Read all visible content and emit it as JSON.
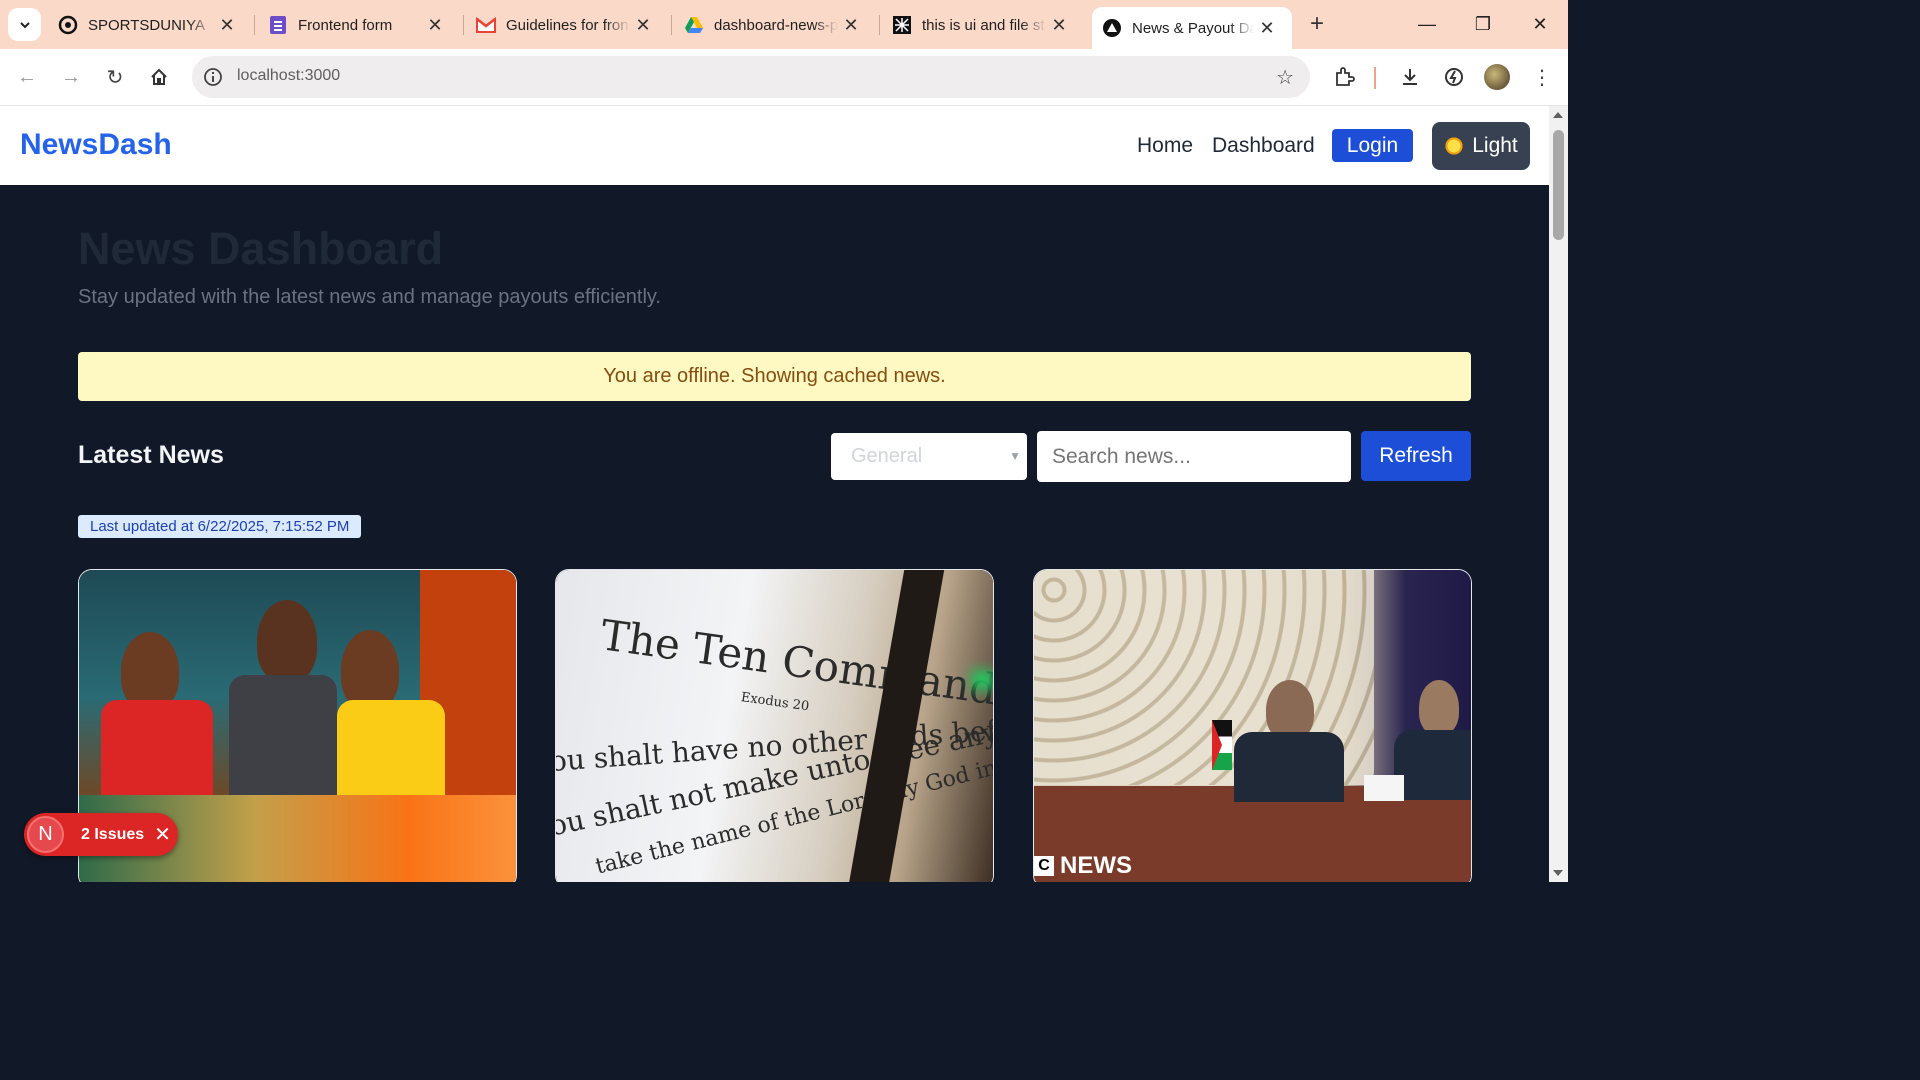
{
  "browser": {
    "tabs": [
      {
        "title": "SPORTSDUNIYA",
        "icon": "sportsduniya-icon"
      },
      {
        "title": "Frontend form",
        "icon": "forms-icon"
      },
      {
        "title": "Guidelines for fron",
        "icon": "gmail-icon"
      },
      {
        "title": "dashboard-news-p",
        "icon": "drive-icon"
      },
      {
        "title": "this is ui and file st",
        "icon": "grid-app-icon"
      },
      {
        "title": "News & Payout Da",
        "icon": "vercel-icon",
        "active": true
      }
    ],
    "url": "localhost:3000"
  },
  "navbar": {
    "brand": "NewsDash",
    "links": [
      "Home",
      "Dashboard"
    ],
    "login_label": "Login",
    "theme_label": "Light"
  },
  "hero": {
    "title": "News Dashboard",
    "subtitle": "Stay updated with the latest news and manage payouts efficiently."
  },
  "offline_banner": "You are offline. Showing cached news.",
  "news": {
    "heading": "Latest News",
    "category_selected": "General",
    "search_placeholder": "Search news...",
    "refresh_label": "Refresh",
    "last_updated": "Last updated at 6/22/2025, 7:15:52 PM",
    "cards": [
      {
        "image": "women-portrait-image"
      },
      {
        "image": "ten-commandments-image",
        "image_text": [
          "The Ten Commandments",
          "Exodus 20",
          "ou shalt have no other gods before Me",
          "ou shalt not make unto thee any graven image",
          "take the name of the Lord thy God in vain"
        ]
      },
      {
        "image": "meeting-image",
        "image_text": [
          "NEWS"
        ]
      }
    ]
  },
  "issues_badge": {
    "letter": "N",
    "label": "2 Issues"
  },
  "colors": {
    "accent": "#2563eb",
    "page_bg": "#111827",
    "banner_bg": "#fef9c3",
    "issues": "#dc2626"
  }
}
